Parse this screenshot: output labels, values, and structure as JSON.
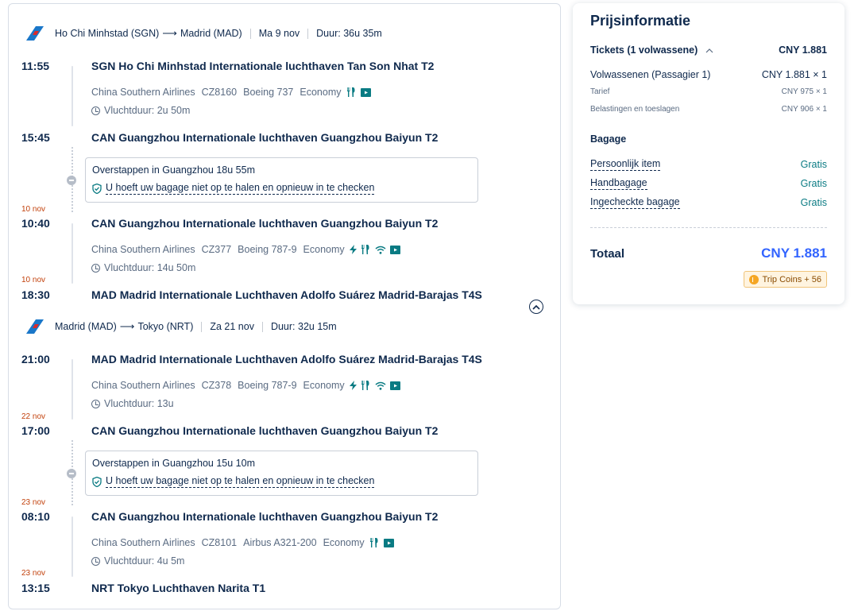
{
  "colors": {
    "accent_blue": "#3264ff",
    "green": "#0a7b83",
    "orange_date": "#c2410c",
    "text_dark": "#0f294d",
    "text_muted": "#5a6b82"
  },
  "legs": [
    {
      "header": {
        "route_from": "Ho Chi Minhstad (SGN)",
        "arrow": "⟶",
        "route_to": "Madrid (MAD)",
        "date": "Ma 9 nov",
        "duration": "Duur: 36u 35m"
      },
      "segments": [
        {
          "dep_time": "11:55",
          "dep_airport": "SGN Ho Chi Minhstad Internationale luchthaven Tan Son Nhat T2",
          "airline": "China Southern Airlines",
          "flight": "CZ8160",
          "aircraft": "Boeing 737",
          "cabin": "Economy",
          "flight_duration": "Vluchtduur: 2u 50m",
          "amenities": [
            "meal-icon",
            "entertainment-icon"
          ],
          "arr_date": "",
          "arr_time": "15:45",
          "arr_airport": "CAN Guangzhou Internationale luchthaven Guangzhou Baiyun T2"
        },
        {
          "transfer": "Overstappen in Guangzhou  18u 55m",
          "baggage_note": "U hoeft uw bagage niet op te halen en opnieuw in te checken"
        },
        {
          "dep_date": "10 nov",
          "dep_time": "10:40",
          "dep_airport": "CAN Guangzhou Internationale luchthaven Guangzhou Baiyun T2",
          "airline": "China Southern Airlines",
          "flight": "CZ377",
          "aircraft": "Boeing 787-9",
          "cabin": "Economy",
          "flight_duration": "Vluchtduur: 14u 50m",
          "amenities": [
            "power-icon",
            "meal-icon",
            "wifi-icon",
            "entertainment-icon"
          ],
          "arr_date": "10 nov",
          "arr_time": "18:30",
          "arr_airport": "MAD Madrid Internationale Luchthaven Adolfo Suárez Madrid-Barajas T4S"
        }
      ]
    },
    {
      "header": {
        "route_from": "Madrid (MAD)",
        "arrow": "⟶",
        "route_to": "Tokyo (NRT)",
        "date": "Za 21 nov",
        "duration": "Duur: 32u 15m"
      },
      "segments": [
        {
          "dep_time": "21:00",
          "dep_airport": "MAD Madrid Internationale Luchthaven Adolfo Suárez Madrid-Barajas T4S",
          "airline": "China Southern Airlines",
          "flight": "CZ378",
          "aircraft": "Boeing 787-9",
          "cabin": "Economy",
          "flight_duration": "Vluchtduur: 13u",
          "amenities": [
            "power-icon",
            "meal-icon",
            "wifi-icon",
            "entertainment-icon"
          ],
          "arr_date": "22 nov",
          "arr_time": "17:00",
          "arr_airport": "CAN Guangzhou Internationale luchthaven Guangzhou Baiyun T2"
        },
        {
          "transfer": "Overstappen in Guangzhou  15u 10m",
          "baggage_note": "U hoeft uw bagage niet op te halen en opnieuw in te checken"
        },
        {
          "dep_date": "23 nov",
          "dep_time": "08:10",
          "dep_airport": "CAN Guangzhou Internationale luchthaven Guangzhou Baiyun T2",
          "airline": "China Southern Airlines",
          "flight": "CZ8101",
          "aircraft": "Airbus A321-200",
          "cabin": "Economy",
          "flight_duration": "Vluchtduur: 4u 5m",
          "amenities": [
            "meal-icon",
            "entertainment-icon"
          ],
          "arr_date": "23 nov",
          "arr_time": "13:15",
          "arr_airport": "NRT Tokyo Luchthaven Narita T1"
        }
      ]
    }
  ],
  "price": {
    "title": "Prijsinformatie",
    "tickets_label": "Tickets (1 volwassene)",
    "tickets_value": "CNY 1.881",
    "adults_label": "Volwassenen (Passagier 1)",
    "adults_value": "CNY 1.881 × 1",
    "fare_label": "Tarief",
    "fare_value": "CNY 975 × 1",
    "taxes_label": "Belastingen en toeslagen",
    "taxes_value": "CNY 906 × 1",
    "baggage_title": "Bagage",
    "baggage": [
      {
        "label": "Persoonlijk item",
        "value": "Gratis"
      },
      {
        "label": "Handbagage",
        "value": "Gratis"
      },
      {
        "label": "Ingecheckte bagage",
        "value": "Gratis"
      }
    ],
    "total_label": "Totaal",
    "total_value": "CNY 1.881",
    "coins": "Trip Coins + 56"
  }
}
